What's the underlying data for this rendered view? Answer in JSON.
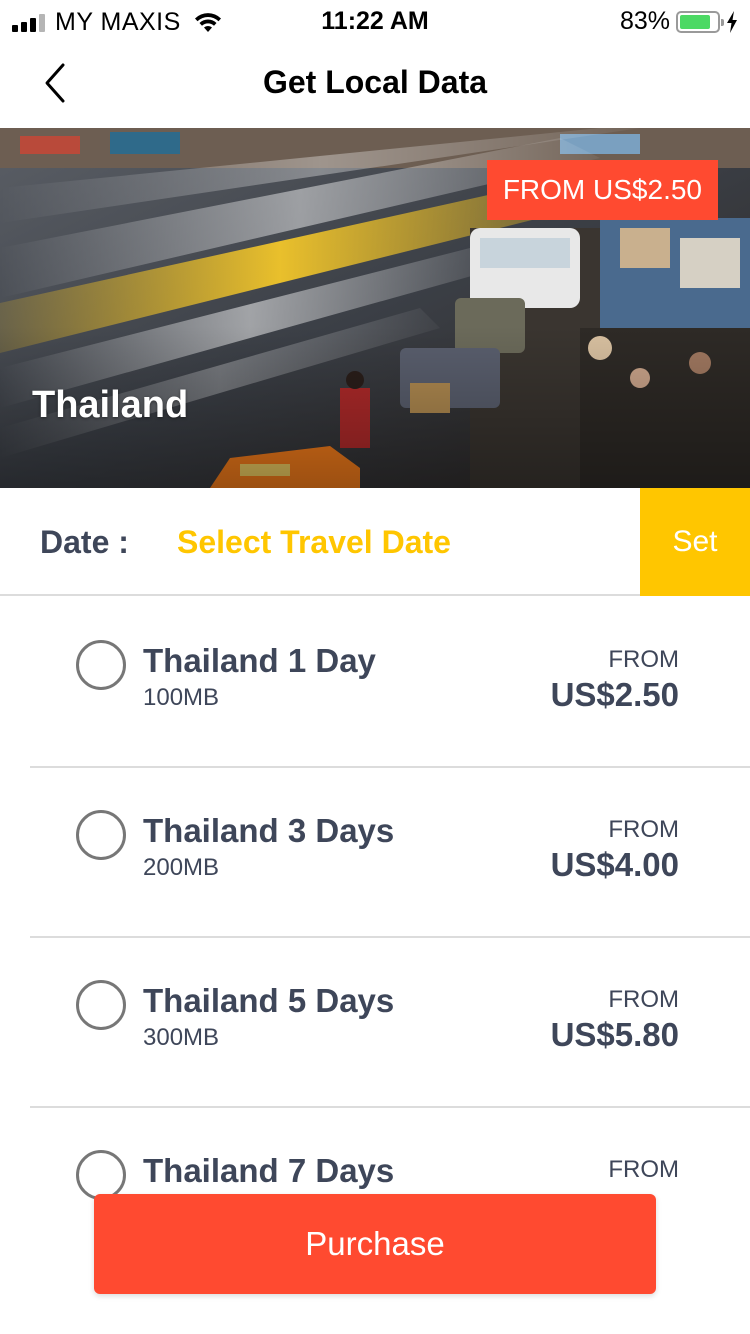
{
  "status_bar": {
    "carrier": "MY MAXIS",
    "time": "11:22 AM",
    "battery_percent": "83%",
    "battery_level": 0.83,
    "icons": [
      "signal-icon",
      "wifi-icon",
      "battery-icon",
      "charging-bolt-icon"
    ]
  },
  "nav": {
    "title": "Get Local Data",
    "back_icon": "chevron-left-icon"
  },
  "hero": {
    "badge": "FROM US$2.50",
    "country": "Thailand"
  },
  "date": {
    "label": "Date :",
    "placeholder": "Select Travel Date",
    "set_label": "Set"
  },
  "plans": [
    {
      "name": "Thailand 1 Day",
      "data": "100MB",
      "from": "FROM",
      "price": "US$2.50"
    },
    {
      "name": "Thailand 3 Days",
      "data": "200MB",
      "from": "FROM",
      "price": "US$4.00"
    },
    {
      "name": "Thailand 5 Days",
      "data": "300MB",
      "from": "FROM",
      "price": "US$5.80"
    },
    {
      "name": "Thailand 7 Days",
      "data": "",
      "from": "FROM",
      "price": ""
    }
  ],
  "purchase_label": "Purchase",
  "colors": {
    "accent_red": "#ff4a30",
    "accent_yellow": "#ffc600",
    "text_dark": "#3e4659",
    "battery_green": "#4cd964"
  }
}
